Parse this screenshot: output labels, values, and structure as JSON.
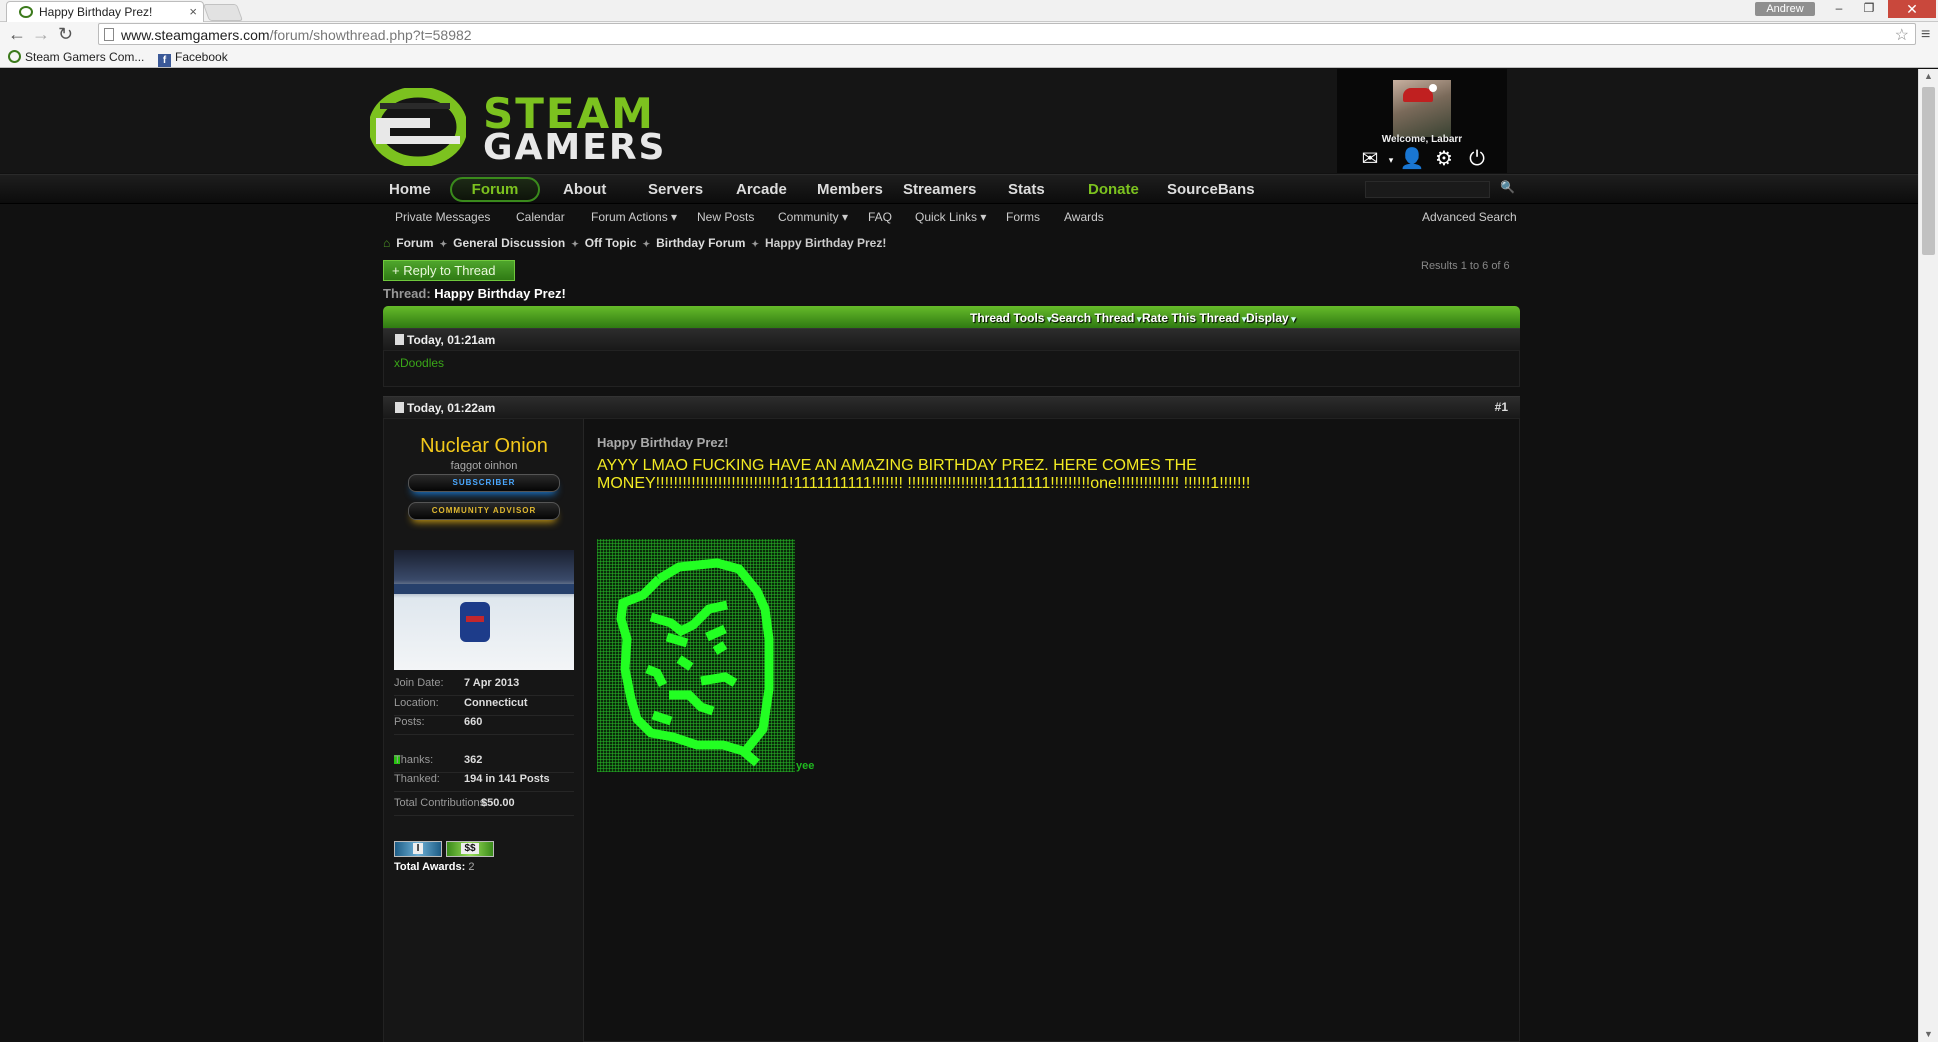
{
  "browser": {
    "tab_title": "Happy Birthday Prez!",
    "tab_close": "×",
    "user_badge": "Andrew",
    "url_host": "www.steamgamers.com",
    "url_path": "/forum/showthread.php?t=58982",
    "bookmarks": [
      "Steam Gamers Com...",
      "Facebook"
    ]
  },
  "site": {
    "logo_line1": "STEAM",
    "logo_line2": "GAMERS",
    "welcome": "Welcome, Labarr"
  },
  "nav": {
    "items": [
      "Home",
      "Forum",
      "About",
      "Servers",
      "Arcade",
      "Members",
      "Streamers",
      "Stats",
      "Donate",
      "SourceBans"
    ]
  },
  "subnav": {
    "items": [
      "Private Messages",
      "Calendar",
      "Forum Actions ▾",
      "New Posts",
      "Community ▾",
      "FAQ",
      "Quick Links ▾",
      "Forms",
      "Awards"
    ],
    "advanced_search": "Advanced Search"
  },
  "breadcrumbs": [
    "Forum",
    "General Discussion",
    "Off Topic",
    "Birthday Forum",
    "Happy Birthday Prez!"
  ],
  "thread": {
    "reply_button": "+ Reply to Thread",
    "results": "Results 1 to 6 of 6",
    "label": "Thread:",
    "title": "Happy Birthday Prez!",
    "tools": [
      "Thread Tools",
      "Search Thread",
      "Rate This Thread",
      "Display"
    ]
  },
  "posts": [
    {
      "date": "Today, 01:21am",
      "username": "xDoodles"
    },
    {
      "date": "Today, 01:22am",
      "number": "#1",
      "username": "Nuclear Onion",
      "user_title": "faggot oinhon",
      "ranks": [
        "SUBSCRIBER",
        "COMMUNITY ADVISOR"
      ],
      "stats": [
        {
          "key": "Join Date:",
          "value": "7 Apr 2013"
        },
        {
          "key": "Location:",
          "value": "Connecticut"
        },
        {
          "key": "Posts:",
          "value": "660"
        },
        {
          "key": "Thanks:",
          "value": "362"
        },
        {
          "key": "Thanked:",
          "value": "194 in 141 Posts"
        },
        {
          "key": "Total Contributions:",
          "value": "$50.00"
        }
      ],
      "awards": [
        "I",
        "$$"
      ],
      "total_awards_label": "Total Awards:",
      "total_awards": "2",
      "title": "Happy Birthday Prez!",
      "body": "AYYY LMAO FUCKING HAVE AN AMAZING BIRTHDAY PREZ. HERE COMES THE MONEY!!!!!!!!!!!!!!!!!!!!!!!!!!!!1!1111111111!!!!!!! !!!!!!!!!!!!!!!!!!11111111!!!!!!!!!one!!!!!!!!!!!!!! !!!!!!1!!!!!!!",
      "art_caption": "yee"
    }
  ],
  "colors": {
    "accent_green": "#7cc21f",
    "username_gold": "#f2c81b",
    "post_text_yellow": "#f2ea22"
  }
}
